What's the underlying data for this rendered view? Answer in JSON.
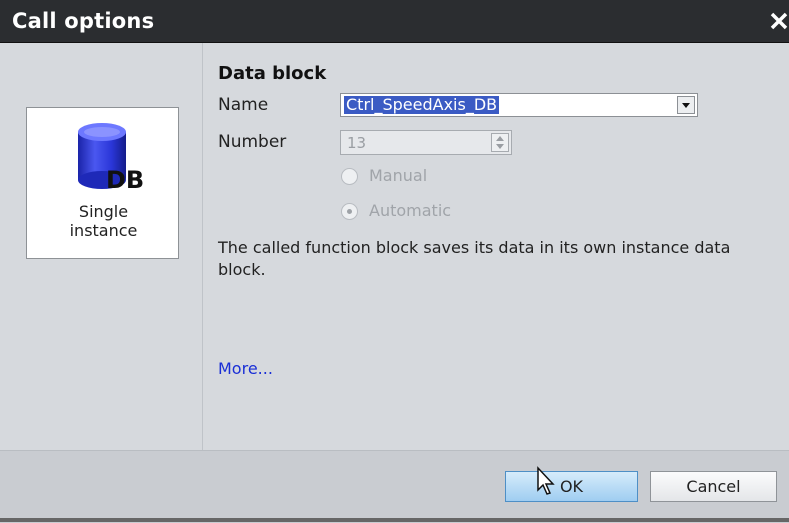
{
  "dialog": {
    "title": "Call options",
    "close_icon": "close-icon"
  },
  "left": {
    "tile_icon_text": "DB",
    "tile_label": "Single instance",
    "tile_icon": "database-cylinder-icon"
  },
  "form": {
    "section_title": "Data block",
    "name_label": "Name",
    "name_value": "Ctrl_SpeedAxis_DB",
    "number_label": "Number",
    "number_value": "13",
    "manual_label": "Manual",
    "automatic_label": "Automatic",
    "automatic_selected": true,
    "description": "The called function block saves its data in its own instance data block.",
    "more_link": "More..."
  },
  "buttons": {
    "ok": "OK",
    "cancel": "Cancel"
  },
  "colors": {
    "titlebar": "#2b2d30",
    "panel_bg": "#d6d9dd",
    "selection": "#3b5bc4",
    "link": "#1a2fd6",
    "db_blue": "#2233cc"
  }
}
